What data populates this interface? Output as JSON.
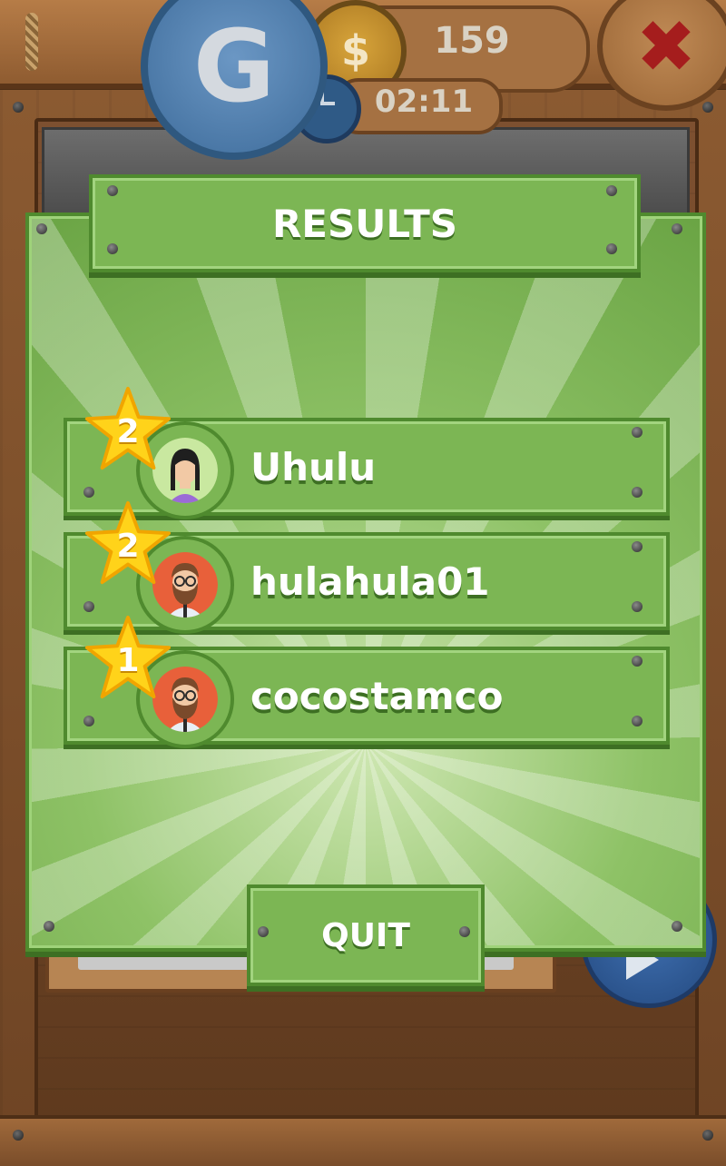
{
  "topbar": {
    "coins_value": "159",
    "coin_symbol": "$",
    "timer_value": "02:11",
    "logo_letter": "G",
    "close_symbol": "✖"
  },
  "modal": {
    "title": "RESULTS",
    "rows": [
      {
        "rank": "2",
        "name": "Uhulu",
        "avatar": "female-avatar-icon"
      },
      {
        "rank": "2",
        "name": "hulahula01",
        "avatar": "bearded-man-avatar-icon"
      },
      {
        "rank": "1",
        "name": "cocostamco",
        "avatar": "bearded-man-avatar-icon"
      }
    ],
    "quit_label": "QUIT"
  },
  "colors": {
    "panel_green": "#7cb654",
    "panel_border": "#4f8a2e",
    "star_yellow": "#ffd31a",
    "wood": "#8b5a31",
    "close_red": "#a51d1d"
  }
}
